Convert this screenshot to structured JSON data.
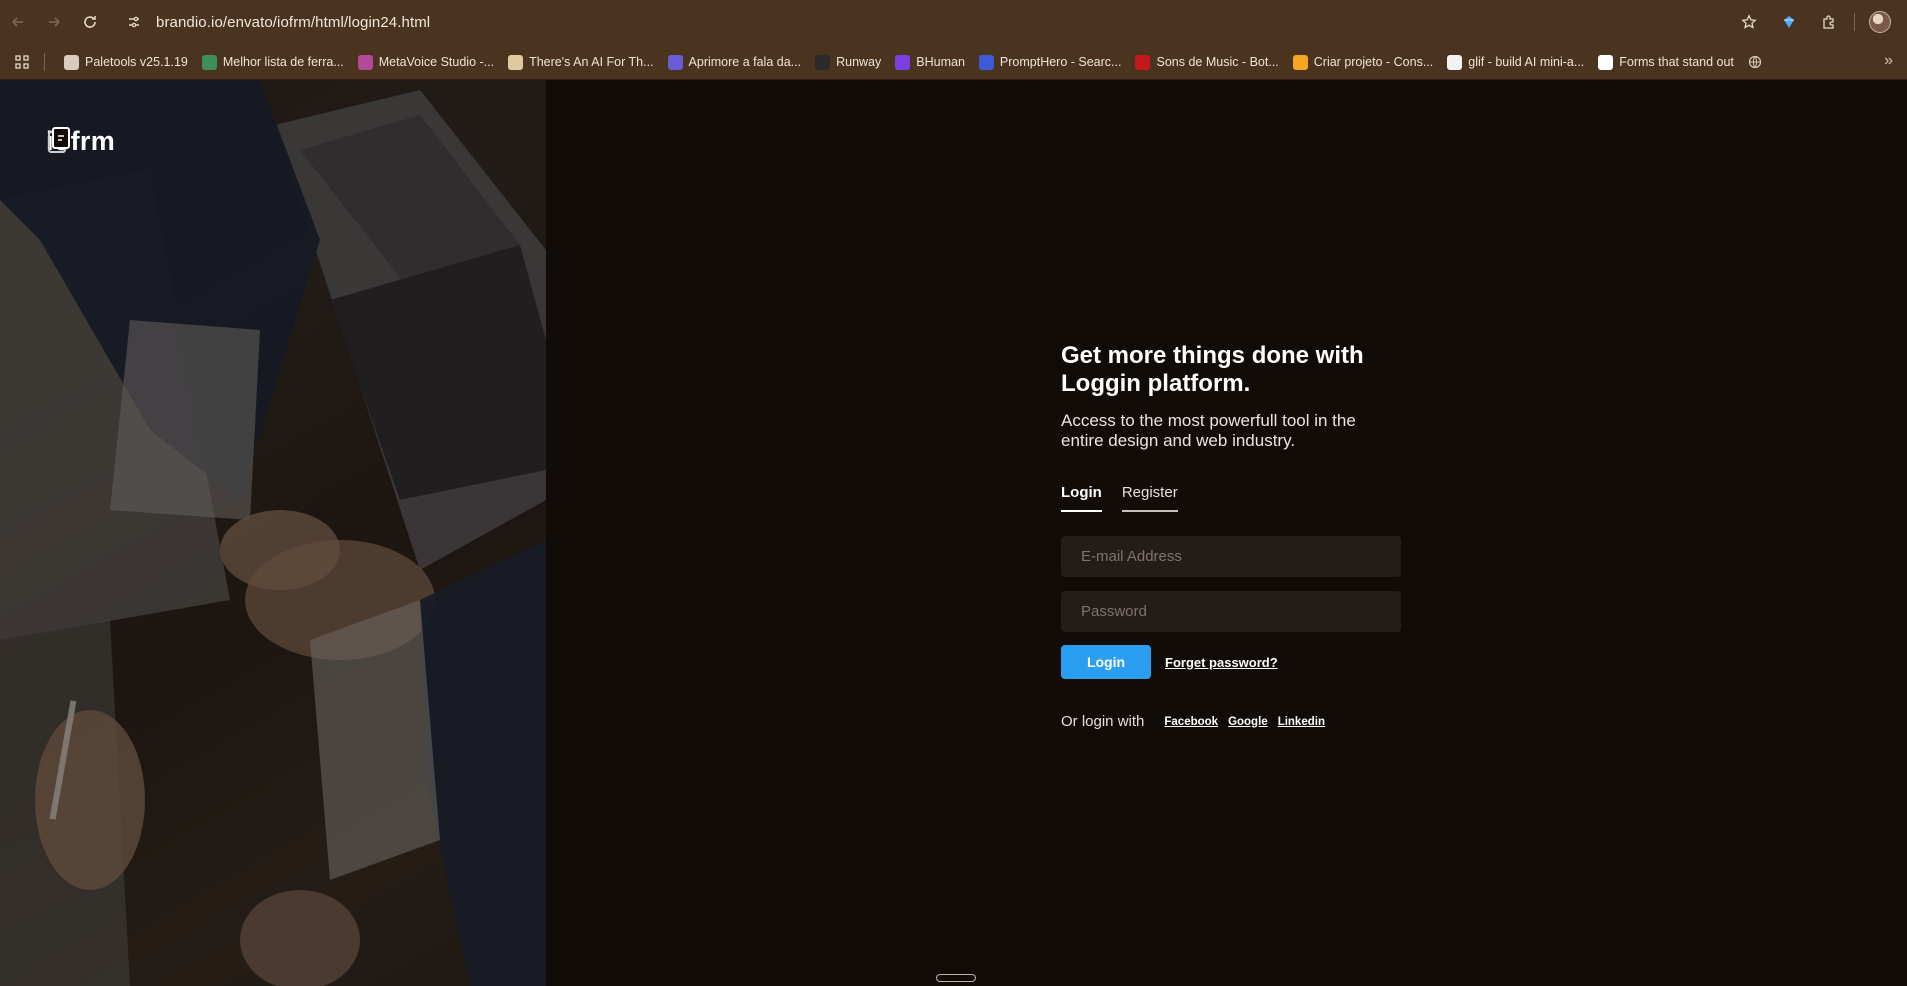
{
  "browser": {
    "url": "brandio.io/envato/iofrm/html/login24.html",
    "bookmarks": [
      {
        "label": "Paletools v25.1.19",
        "icon": "globe-icon",
        "color": "#d9cbbd"
      },
      {
        "label": "Melhor lista de ferra...",
        "icon": "leaf-icon",
        "color": "#3f8f5a"
      },
      {
        "label": "MetaVoice Studio -...",
        "icon": "heart-icon",
        "color": "#b24a9a"
      },
      {
        "label": "There's An AI For Th...",
        "icon": "flex-icon",
        "color": "#e0c9a0"
      },
      {
        "label": "Aprimore a fala da...",
        "icon": "accessibility-icon",
        "color": "#6a5cd6"
      },
      {
        "label": "Runway",
        "icon": "runway-icon",
        "color": "#2b2b2b"
      },
      {
        "label": "BHuman",
        "icon": "b-icon",
        "color": "#7b3fe4"
      },
      {
        "label": "PromptHero - Searc...",
        "icon": "prompthero-icon",
        "color": "#3d5bd9"
      },
      {
        "label": "Sons de Music - Bot...",
        "icon": "music-icon",
        "color": "#c4161c"
      },
      {
        "label": "Criar projeto - Cons...",
        "icon": "firebase-icon",
        "color": "#f5a623"
      },
      {
        "label": "glif - build AI mini-a...",
        "icon": "glif-icon",
        "color": "#f2f2f2"
      },
      {
        "label": "Forms that stand out",
        "icon": "forms-icon",
        "color": "#ffffff"
      }
    ]
  },
  "brand": {
    "name": "iofrm"
  },
  "form": {
    "headline_line1": "Get more things done with",
    "headline_line2": "Loggin platform.",
    "subline_line1": "Access to the most powerfull tool in the",
    "subline_line2": "entire design and web industry.",
    "tabs": [
      {
        "label": "Login",
        "active": true
      },
      {
        "label": "Register",
        "active": false
      }
    ],
    "email_placeholder": "E-mail Address",
    "password_placeholder": "Password",
    "login_button": "Login",
    "forget_link": "Forget password?",
    "social_label": "Or login with",
    "social_links": [
      "Facebook",
      "Google",
      "Linkedin"
    ]
  },
  "colors": {
    "accent": "#2a9ef1",
    "page_bg": "#120c08",
    "chrome_bg": "#4a3420"
  }
}
